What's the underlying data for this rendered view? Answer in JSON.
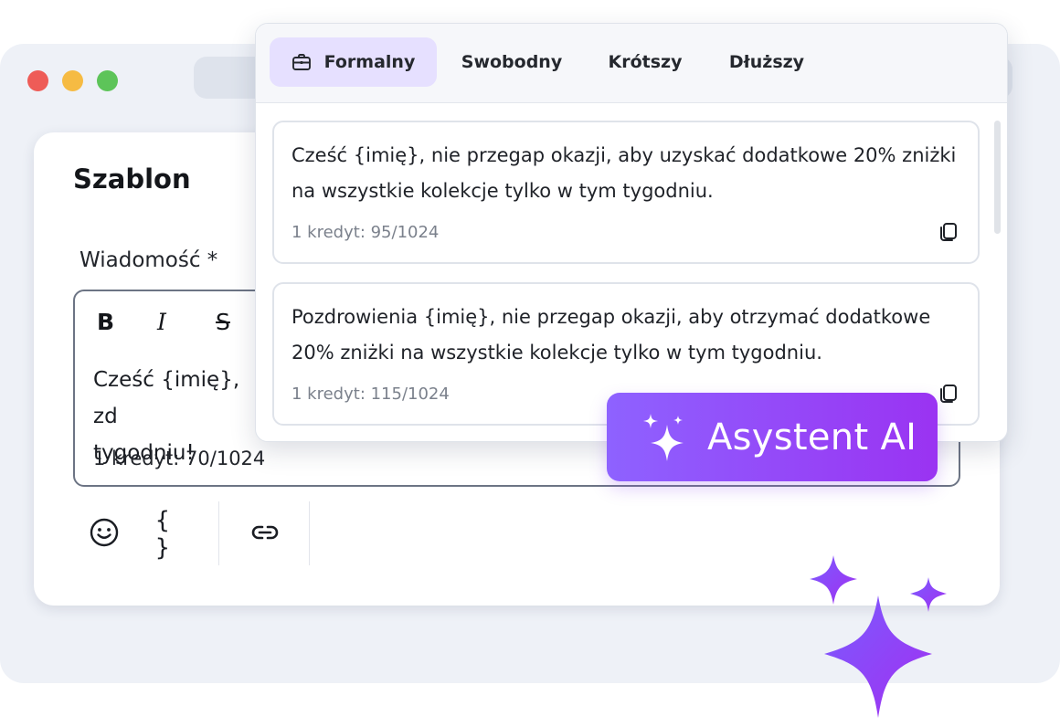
{
  "window": {
    "controls": [
      "close",
      "minimize",
      "maximize"
    ],
    "colors": {
      "close": "#ee5c57",
      "minimize": "#f6bb43",
      "maximize": "#5dc459"
    }
  },
  "template": {
    "title": "Szablon",
    "message_label": "Wiadomość *",
    "editor": {
      "format_buttons": {
        "bold": "B",
        "italic": "I",
        "strike": "S"
      },
      "text": "Cześć {imię}, zd\ntygodniu!",
      "credit_count": "1 kredyt: 70/1024"
    },
    "toolbar": {
      "emoji_icon": "smiley-icon",
      "variable_label": "{ }",
      "link_icon": "link-icon"
    }
  },
  "ai_popup": {
    "tabs": [
      {
        "label": "Formalny",
        "icon": "briefcase-icon",
        "active": true
      },
      {
        "label": "Swobodny",
        "active": false
      },
      {
        "label": "Krótszy",
        "active": false
      },
      {
        "label": "Dłuższy",
        "active": false
      }
    ],
    "suggestions": [
      {
        "text": "Cześć {imię}, nie przegap okazji, aby uzyskać dodatkowe 20% zniżki na wszystkie kolekcje tylko w tym tygodniu.",
        "credit_count": "1 kredyt: 95/1024"
      },
      {
        "text": "Pozdrowienia {imię}, nie przegap okazji, aby otrzymać dodatkowe 20% zniżki na wszystkie kolekcje tylko w tym tygodniu.",
        "credit_count": "1 kredyt: 115/1024"
      }
    ]
  },
  "ai_button": {
    "label": "Asystent AI",
    "icon": "sparkles-icon",
    "gradient": [
      "#8e62ff",
      "#9a33f2"
    ]
  },
  "accent_color": "#8e45f5"
}
